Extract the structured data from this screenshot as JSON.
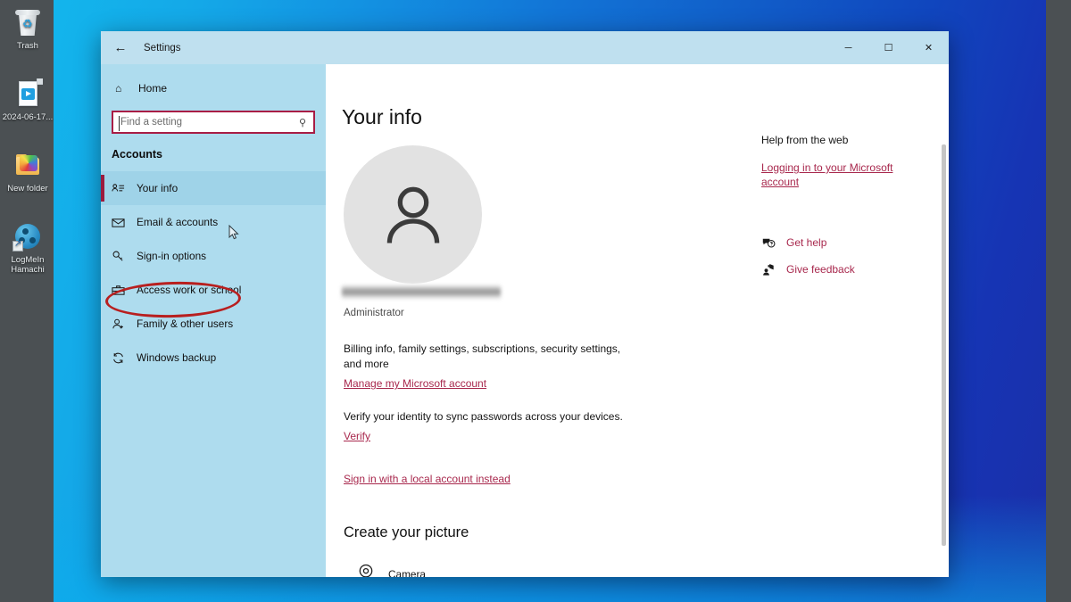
{
  "desktop": {
    "icons": [
      {
        "label": "Trash",
        "icon": "trash-icon"
      },
      {
        "label": "2024-06-17...",
        "icon": "video-file-icon"
      },
      {
        "label": "New folder",
        "icon": "folder-pictures-icon"
      },
      {
        "label": "LogMeIn Hamachi",
        "icon": "logmein-hamachi-icon"
      }
    ],
    "wallpaper_color_left": "#13b5ec",
    "wallpaper_color_right": "#1b2fa8",
    "side_strip_color": "#4b5053"
  },
  "window": {
    "title": "Settings",
    "back_icon": "back-arrow-icon",
    "controls": {
      "minimize": "─",
      "maximize": "☐",
      "close": "✕"
    },
    "titlebar_color": "#bfe0ef"
  },
  "sidebar": {
    "background_color": "#aedcee",
    "home": {
      "label": "Home",
      "icon": "home-icon"
    },
    "search": {
      "placeholder": "Find a setting",
      "value": "",
      "icon": "search-icon",
      "highlight_color": "#a81d45"
    },
    "section_title": "Accounts",
    "selected_index": 0,
    "accent_color": "#9b1b3e",
    "annotation_color": "#b81f1f",
    "annotated_index": 2,
    "items": [
      {
        "label": "Your info",
        "icon": "your-info-icon"
      },
      {
        "label": "Email & accounts",
        "icon": "envelope-icon"
      },
      {
        "label": "Sign-in options",
        "icon": "key-icon"
      },
      {
        "label": "Access work or school",
        "icon": "briefcase-icon"
      },
      {
        "label": "Family & other users",
        "icon": "person-add-icon"
      },
      {
        "label": "Windows backup",
        "icon": "sync-icon"
      }
    ]
  },
  "main": {
    "page_title": "Your info",
    "avatar_icon": "default-user-avatar-icon",
    "account_name_redacted": true,
    "account_role": "Administrator",
    "billing_text": "Billing info, family settings, subscriptions, security settings, and more",
    "manage_account_link": "Manage my Microsoft account",
    "verify_text": "Verify your identity to sync passwords across your devices.",
    "verify_link": "Verify",
    "local_account_link": "Sign in with a local account instead",
    "create_picture_title": "Create your picture",
    "camera_label": "Camera",
    "camera_icon": "camera-icon",
    "link_color": "#a8284d"
  },
  "help": {
    "title": "Help from the web",
    "article_link": "Logging in to your Microsoft account",
    "rows": [
      {
        "label": "Get help",
        "icon": "question-bubble-icon"
      },
      {
        "label": "Give feedback",
        "icon": "feedback-person-icon"
      }
    ]
  }
}
